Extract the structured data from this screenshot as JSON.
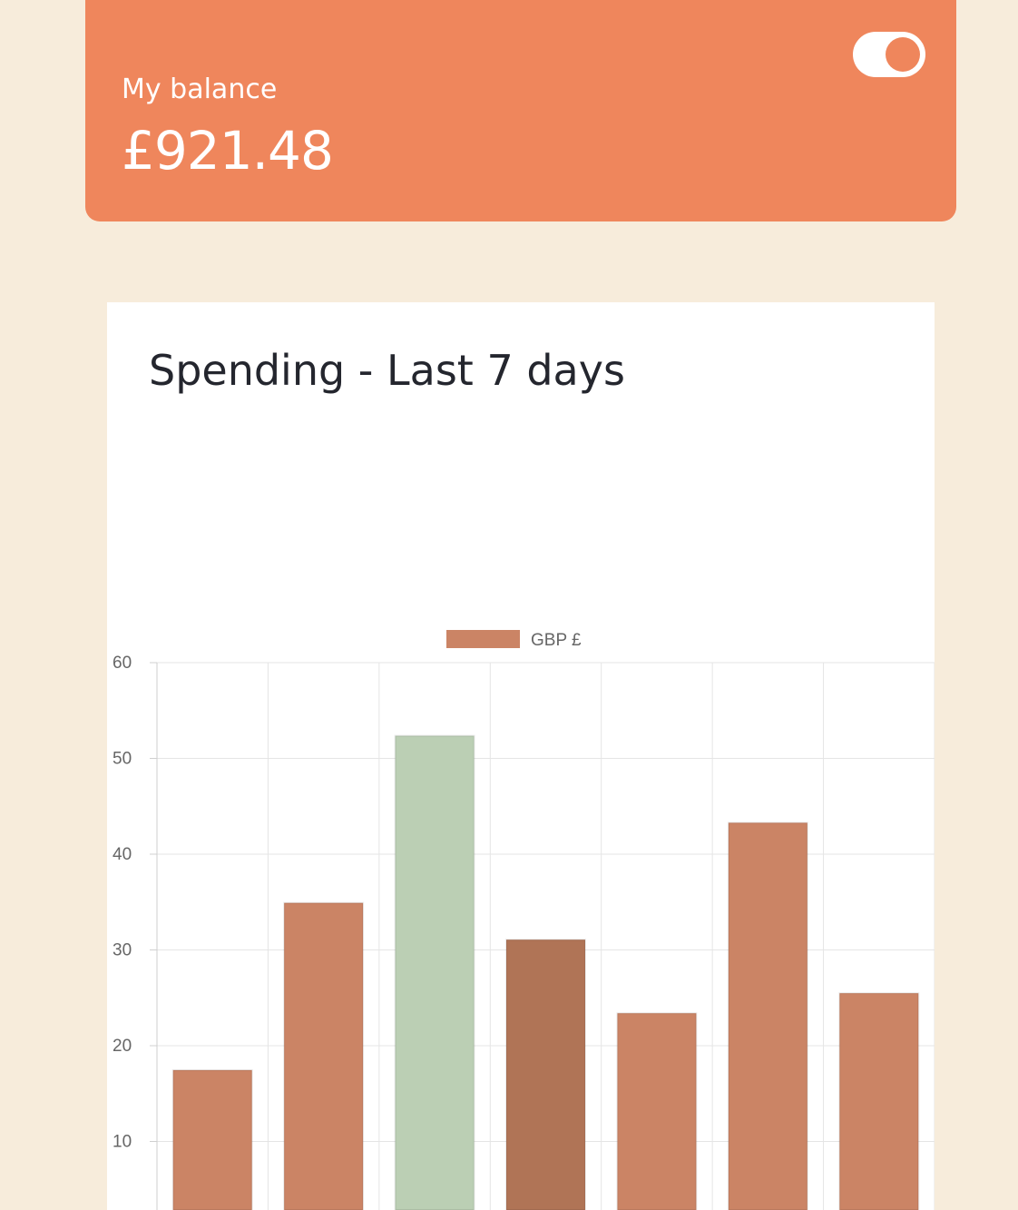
{
  "balance": {
    "label": "My balance",
    "amount": "£921.48",
    "toggle_on": true
  },
  "colors": {
    "background": "#f7ecdb",
    "card_accent": "#ef865c",
    "bar": "#cb8465",
    "bar_highlight_green": "#bbcfb4",
    "bar_dark": "#b07456"
  },
  "chart": {
    "title": "Spending - Last 7 days"
  },
  "chart_data": {
    "type": "bar",
    "title": "Spending - Last 7 days",
    "categories": [
      "",
      "",
      "",
      "",
      "",
      "",
      ""
    ],
    "series": [
      {
        "name": "GBP £",
        "values": [
          17.45,
          34.91,
          52.36,
          31.07,
          23.39,
          43.28,
          25.48
        ],
        "colors": [
          "#cb8465",
          "#cb8465",
          "#bbcfb4",
          "#b07456",
          "#cb8465",
          "#cb8465",
          "#cb8465"
        ]
      }
    ],
    "yticks": [
      10,
      20,
      30,
      40,
      50,
      60
    ],
    "ylim": [
      0,
      60
    ],
    "grid": true,
    "legend": "top-center"
  }
}
